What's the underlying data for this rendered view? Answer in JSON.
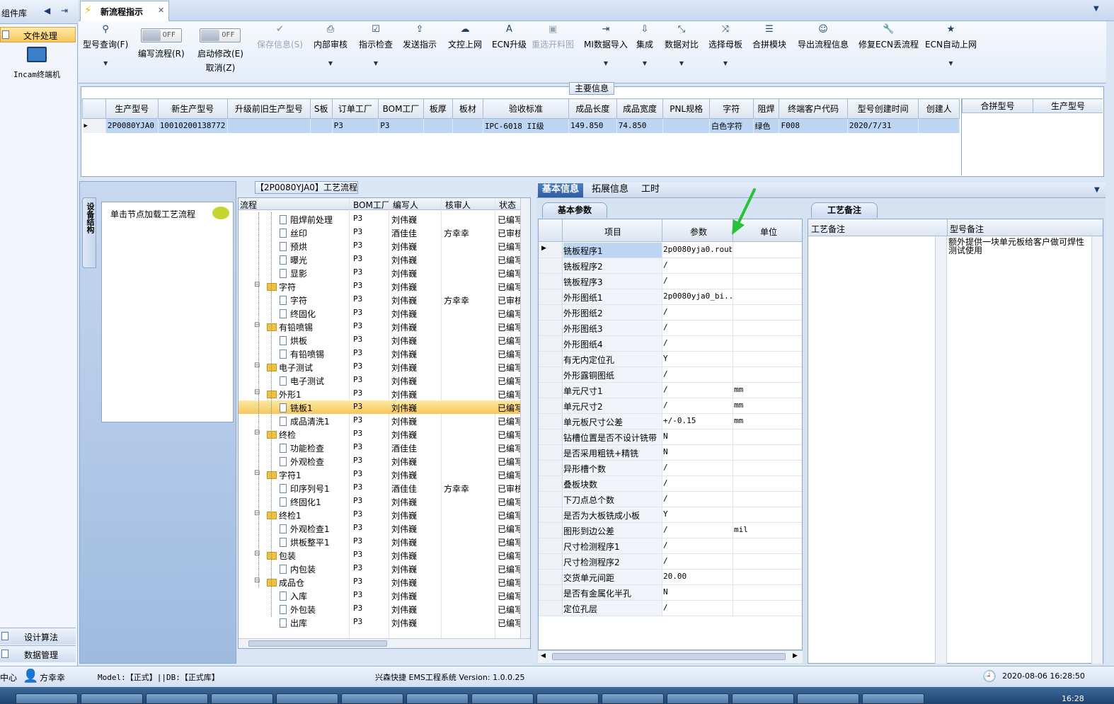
{
  "left": {
    "header": "组件库",
    "selected": "文件处理",
    "terminal": "Incam终端机",
    "bottom": [
      "设计算法",
      "数据管理"
    ]
  },
  "tab": {
    "title": "新流程指示"
  },
  "ribbon": [
    {
      "label": "型号查询(F)",
      "icon": "search-icon",
      "glyph": "⚲",
      "dd": true
    },
    {
      "label": "编写流程(R)",
      "toggle": "OFF"
    },
    {
      "label": "启动修改(E)",
      "label2": "取消(Z)",
      "toggle": "OFF"
    },
    {
      "label": "保存信息(S)",
      "icon": "check-icon",
      "glyph": "✔",
      "disabled": true
    },
    {
      "label": "内部审核",
      "icon": "printer-icon",
      "glyph": "⎙",
      "dd": true
    },
    {
      "label": "指示检查",
      "icon": "checkbox-icon",
      "glyph": "☑",
      "dd": true
    },
    {
      "label": "发送指示",
      "icon": "upload-icon",
      "glyph": "⇪"
    },
    {
      "label": "文控上网",
      "icon": "cloud-icon",
      "glyph": "☁"
    },
    {
      "label": "ECN升级",
      "icon": "text-icon",
      "glyph": "A"
    },
    {
      "label": "重选开料图",
      "icon": "image-icon",
      "glyph": "▣",
      "disabled": true
    },
    {
      "label": "MI数据导入",
      "icon": "import-icon",
      "glyph": "⇥",
      "dd": true
    },
    {
      "label": "集成",
      "icon": "download-icon",
      "glyph": "⇩",
      "dd": true
    },
    {
      "label": "数据对比",
      "icon": "compare-icon",
      "glyph": "⤡",
      "dd": true
    },
    {
      "label": "选择母板",
      "icon": "shuffle-icon",
      "glyph": "⤨",
      "dd": true
    },
    {
      "label": "合拼模块",
      "icon": "list-icon",
      "glyph": "☰"
    },
    {
      "label": "导出流程信息",
      "icon": "smiley-icon",
      "glyph": "☺"
    },
    {
      "label": "修复ECN丢流程",
      "icon": "wrench-icon",
      "glyph": "🔧"
    },
    {
      "label": "ECN自动上网",
      "icon": "star-icon",
      "glyph": "★",
      "dd": true
    }
  ],
  "main_info": {
    "title": "主要信息",
    "columns": [
      "生产型号",
      "新生产型号",
      "升级前旧生产型号",
      "S板",
      "订单工厂",
      "BOM工厂",
      "板厚",
      "板材",
      "验收标准",
      "成品长度",
      "成品宽度",
      "PNL规格",
      "字符",
      "阻焊",
      "终端客户代码",
      "型号创建时间",
      "创建人"
    ],
    "row": [
      "2P0080YJA0",
      "10010200138772",
      "",
      "",
      "P3",
      "P3",
      "",
      "",
      "IPC-6018 II级",
      "149.850",
      "74.850",
      "",
      "白色字符",
      "绿色",
      "F008",
      "2020/7/31",
      ""
    ],
    "side_columns": [
      "合拼型号",
      "生产型号"
    ]
  },
  "nav": {
    "side_tab": "设备结构",
    "hint": "单击节点加载工艺流程"
  },
  "flow": {
    "title": "【2P0080YJA0】工艺流程",
    "columns": [
      "流程",
      "BOM工厂",
      "编写人",
      "核审人",
      "状态"
    ],
    "rows": [
      {
        "name": "阻焊前处理",
        "lvl": 2,
        "bom": "P3",
        "w": "刘伟巍",
        "r": "",
        "s": "已编写"
      },
      {
        "name": "丝印",
        "lvl": 2,
        "bom": "P3",
        "w": "酒佳佳",
        "r": "方幸幸",
        "s": "已审核"
      },
      {
        "name": "预烘",
        "lvl": 2,
        "bom": "P3",
        "w": "刘伟巍",
        "r": "",
        "s": "已编写"
      },
      {
        "name": "曝光",
        "lvl": 2,
        "bom": "P3",
        "w": "刘伟巍",
        "r": "",
        "s": "已编写"
      },
      {
        "name": "显影",
        "lvl": 2,
        "bom": "P3",
        "w": "刘伟巍",
        "r": "",
        "s": "已编写"
      },
      {
        "name": "字符",
        "lvl": 1,
        "bom": "P3",
        "w": "刘伟巍",
        "r": "",
        "s": "已编写"
      },
      {
        "name": "字符",
        "lvl": 2,
        "bom": "P3",
        "w": "刘伟巍",
        "r": "方幸幸",
        "s": "已审核"
      },
      {
        "name": "终固化",
        "lvl": 2,
        "bom": "P3",
        "w": "刘伟巍",
        "r": "",
        "s": "已编写"
      },
      {
        "name": "有铅喷锡",
        "lvl": 1,
        "bom": "P3",
        "w": "刘伟巍",
        "r": "",
        "s": "已编写"
      },
      {
        "name": "烘板",
        "lvl": 2,
        "bom": "P3",
        "w": "刘伟巍",
        "r": "",
        "s": "已编写"
      },
      {
        "name": "有铅喷锡",
        "lvl": 2,
        "bom": "P3",
        "w": "刘伟巍",
        "r": "",
        "s": "已编写"
      },
      {
        "name": "电子测试",
        "lvl": 1,
        "bom": "P3",
        "w": "刘伟巍",
        "r": "",
        "s": "已编写"
      },
      {
        "name": "电子测试",
        "lvl": 2,
        "bom": "P3",
        "w": "刘伟巍",
        "r": "",
        "s": "已编写"
      },
      {
        "name": "外形1",
        "lvl": 1,
        "bom": "P3",
        "w": "刘伟巍",
        "r": "",
        "s": "已编写"
      },
      {
        "name": "铣板1",
        "lvl": 2,
        "bom": "P3",
        "w": "刘伟巍",
        "r": "",
        "s": "已编写",
        "sel": true
      },
      {
        "name": "成品清洗1",
        "lvl": 2,
        "bom": "P3",
        "w": "刘伟巍",
        "r": "",
        "s": "已编写"
      },
      {
        "name": "终检",
        "lvl": 1,
        "bom": "P3",
        "w": "刘伟巍",
        "r": "",
        "s": "已编写"
      },
      {
        "name": "功能检查",
        "lvl": 2,
        "bom": "P3",
        "w": "酒佳佳",
        "r": "",
        "s": "已编写"
      },
      {
        "name": "外观检查",
        "lvl": 2,
        "bom": "P3",
        "w": "刘伟巍",
        "r": "",
        "s": "已编写"
      },
      {
        "name": "字符1",
        "lvl": 1,
        "bom": "P3",
        "w": "刘伟巍",
        "r": "",
        "s": "已编写"
      },
      {
        "name": "印序列号1",
        "lvl": 2,
        "bom": "P3",
        "w": "酒佳佳",
        "r": "方幸幸",
        "s": "已审核"
      },
      {
        "name": "终固化1",
        "lvl": 2,
        "bom": "P3",
        "w": "刘伟巍",
        "r": "",
        "s": "已编写"
      },
      {
        "name": "终检1",
        "lvl": 1,
        "bom": "P3",
        "w": "刘伟巍",
        "r": "",
        "s": "已编写"
      },
      {
        "name": "外观检查1",
        "lvl": 2,
        "bom": "P3",
        "w": "刘伟巍",
        "r": "",
        "s": "已编写"
      },
      {
        "name": "烘板整平1",
        "lvl": 2,
        "bom": "P3",
        "w": "刘伟巍",
        "r": "",
        "s": "已编写"
      },
      {
        "name": "包装",
        "lvl": 1,
        "bom": "P3",
        "w": "刘伟巍",
        "r": "",
        "s": "已编写"
      },
      {
        "name": "内包装",
        "lvl": 2,
        "bom": "P3",
        "w": "刘伟巍",
        "r": "",
        "s": "已编写"
      },
      {
        "name": "成品仓",
        "lvl": 1,
        "bom": "P3",
        "w": "刘伟巍",
        "r": "",
        "s": "已编写"
      },
      {
        "name": "入库",
        "lvl": 2,
        "bom": "P3",
        "w": "刘伟巍",
        "r": "",
        "s": "已编写"
      },
      {
        "name": "外包装",
        "lvl": 2,
        "bom": "P3",
        "w": "刘伟巍",
        "r": "",
        "s": "已编写"
      },
      {
        "name": "出库",
        "lvl": 2,
        "bom": "P3",
        "w": "刘伟巍",
        "r": "",
        "s": "已编写"
      }
    ]
  },
  "right_tabs": [
    "基本信息",
    "拓展信息",
    "工时"
  ],
  "params": {
    "tab": "基本参数",
    "columns": [
      "项目",
      "参数",
      "单位"
    ],
    "rows": [
      [
        "铣板程序1",
        "2p0080yja0.roubk",
        ""
      ],
      [
        "铣板程序2",
        "/",
        ""
      ],
      [
        "铣板程序3",
        "/",
        ""
      ],
      [
        "外形图纸1",
        "2p0080yja0_bi...",
        ""
      ],
      [
        "外形图纸2",
        "/",
        ""
      ],
      [
        "外形图纸3",
        "/",
        ""
      ],
      [
        "外形图纸4",
        "/",
        ""
      ],
      [
        "有无内定位孔",
        "Y",
        ""
      ],
      [
        "外形露铜图纸",
        "/",
        ""
      ],
      [
        "单元尺寸1",
        "/",
        "mm"
      ],
      [
        "单元尺寸2",
        "/",
        "mm"
      ],
      [
        "单元板尺寸公差",
        "+/-0.15",
        "mm"
      ],
      [
        "钻槽位置是否不设计铣带",
        "N",
        ""
      ],
      [
        "是否采用粗铣+精铣",
        "N",
        ""
      ],
      [
        "异形槽个数",
        "/",
        ""
      ],
      [
        "叠板块数",
        "/",
        ""
      ],
      [
        "下刀点总个数",
        "/",
        ""
      ],
      [
        "是否为大板铣成小板",
        "Y",
        ""
      ],
      [
        "图形到边公差",
        "/",
        "mil"
      ],
      [
        "尺寸检测程序1",
        "/",
        ""
      ],
      [
        "尺寸检测程序2",
        "/",
        ""
      ],
      [
        "交货单元间距",
        "20.00",
        ""
      ],
      [
        "是否有金属化半孔",
        "N",
        ""
      ],
      [
        "定位孔层",
        "/",
        ""
      ]
    ]
  },
  "notes": {
    "tab": "工艺备注",
    "columns": [
      "工艺备注",
      "型号备注"
    ],
    "model_note": "额外提供一块单元板给客户做可焊性测试使用"
  },
  "status": {
    "center": "中心",
    "user": "方幸幸",
    "model_db": "Model:【正式】||DB:【正式库】",
    "app": "兴森快捷 EMS工程系统 Version: 1.0.0.25",
    "datetime": "2020-08-06 16:28:50"
  },
  "taskbar": {
    "clock": "16:28"
  }
}
